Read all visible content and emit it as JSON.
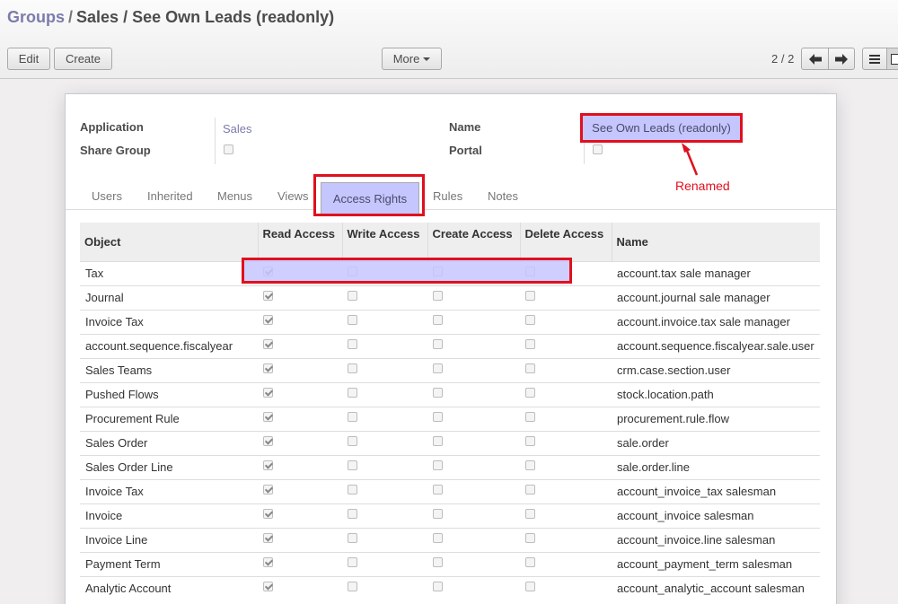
{
  "breadcrumb": {
    "root": "Groups",
    "separator": "/",
    "current": "Sales / See Own Leads (readonly)"
  },
  "toolbar": {
    "edit_label": "Edit",
    "create_label": "Create",
    "more_label": "More",
    "pager": "2 / 2"
  },
  "form": {
    "application_label": "Application",
    "application_value": "Sales",
    "share_group_label": "Share Group",
    "name_label": "Name",
    "name_value": "See Own Leads (readonly)",
    "portal_label": "Portal"
  },
  "annotation": "Renamed",
  "tabs": [
    {
      "label": "Users"
    },
    {
      "label": "Inherited"
    },
    {
      "label": "Menus"
    },
    {
      "label": "Views"
    },
    {
      "label": "Access Rights",
      "active": true
    },
    {
      "label": "Rules"
    },
    {
      "label": "Notes"
    }
  ],
  "columns": {
    "object": "Object",
    "read": "Read Access",
    "write": "Write Access",
    "create": "Create Access",
    "delete": "Delete Access",
    "name": "Name"
  },
  "rows": [
    {
      "object": "Tax",
      "name": "account.tax sale manager"
    },
    {
      "object": "Journal",
      "name": "account.journal sale manager"
    },
    {
      "object": "Invoice Tax",
      "name": "account.invoice.tax sale manager"
    },
    {
      "object": "account.sequence.fiscalyear",
      "name": "account.sequence.fiscalyear.sale.user"
    },
    {
      "object": "Sales Teams",
      "name": "crm.case.section.user"
    },
    {
      "object": "Pushed Flows",
      "name": "stock.location.path"
    },
    {
      "object": "Procurement Rule",
      "name": "procurement.rule.flow"
    },
    {
      "object": "Sales Order",
      "name": "sale.order"
    },
    {
      "object": "Sales Order Line",
      "name": "sale.order.line"
    },
    {
      "object": "Invoice Tax",
      "name": "account_invoice_tax salesman"
    },
    {
      "object": "Invoice",
      "name": "account_invoice salesman"
    },
    {
      "object": "Invoice Line",
      "name": "account_invoice.line salesman"
    },
    {
      "object": "Payment Term",
      "name": "account_payment_term salesman"
    },
    {
      "object": "Analytic Account",
      "name": "account_analytic_account salesman"
    }
  ],
  "colors": {
    "highlight": "#c6c6ff",
    "annotation_red": "#e0101e",
    "link": "#7c7bad"
  }
}
